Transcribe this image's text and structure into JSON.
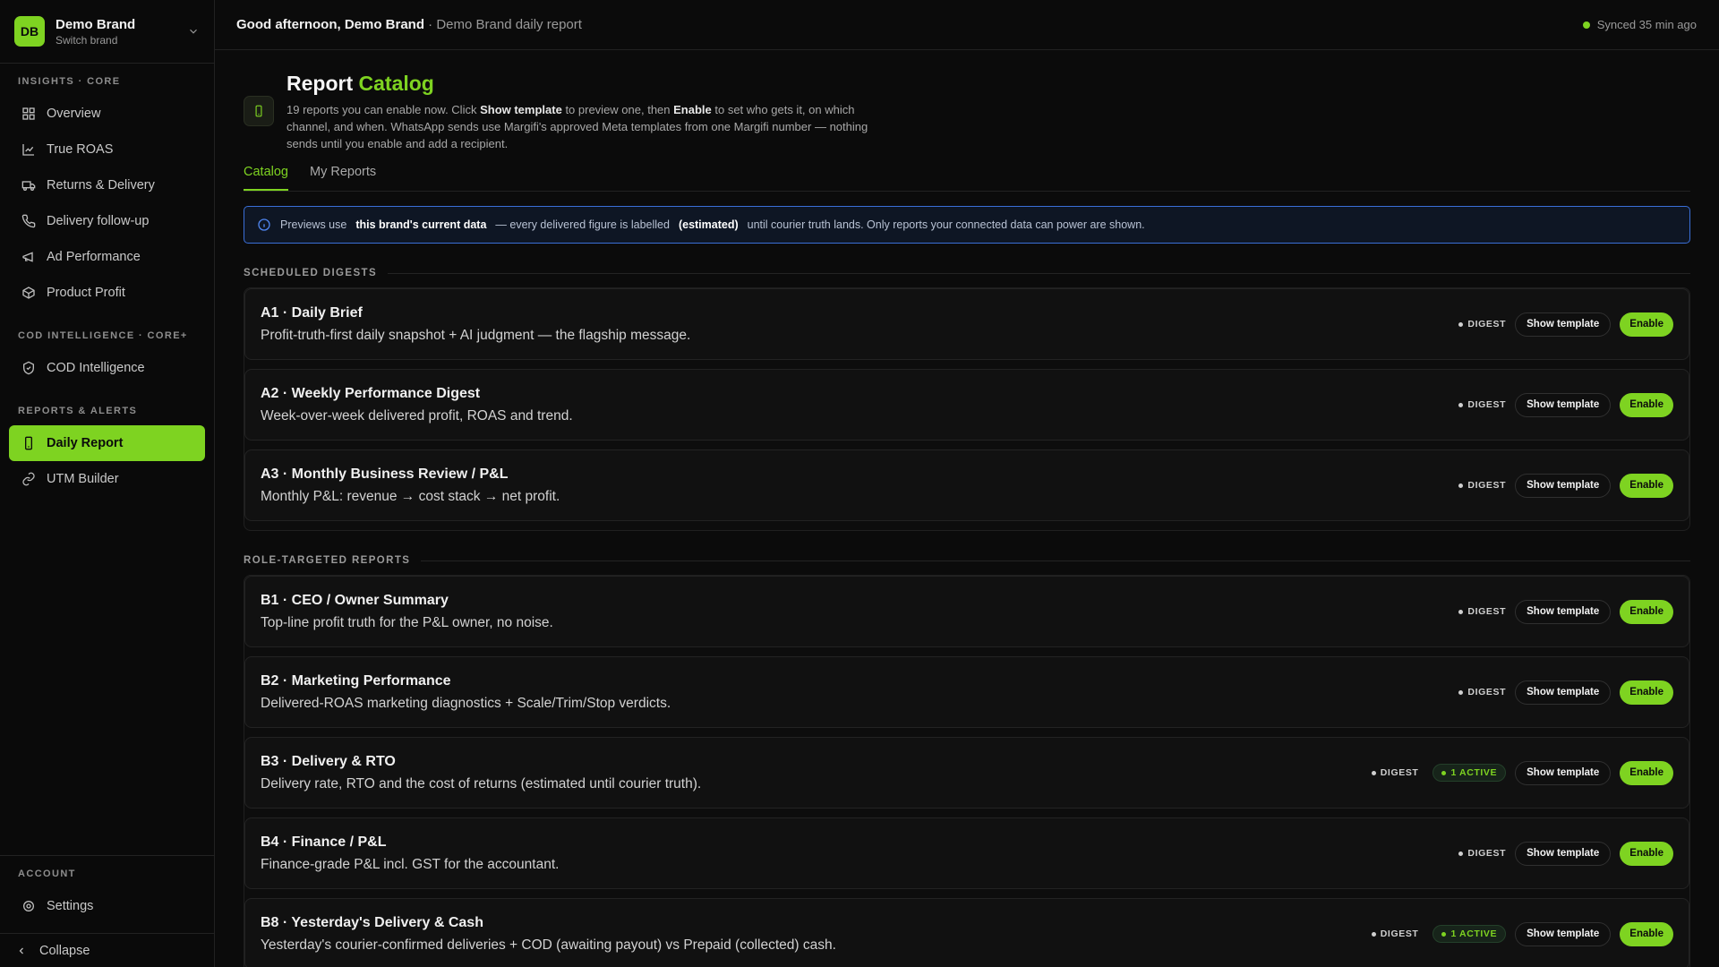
{
  "brand": {
    "initials": "DB",
    "name": "Demo Brand",
    "sub": "Switch brand"
  },
  "sidebar": {
    "sections": [
      {
        "title": "INSIGHTS · CORE",
        "items": [
          {
            "label": "Overview",
            "icon": "grid-icon"
          },
          {
            "label": "True ROAS",
            "icon": "chart-line-icon"
          },
          {
            "label": "Returns & Delivery",
            "icon": "truck-icon"
          },
          {
            "label": "Delivery follow-up",
            "icon": "phone-icon"
          },
          {
            "label": "Ad Performance",
            "icon": "megaphone-icon"
          },
          {
            "label": "Product Profit",
            "icon": "box-icon"
          }
        ]
      },
      {
        "title": "COD INTELLIGENCE · CORE+",
        "items": [
          {
            "label": "COD Intelligence",
            "icon": "shield-icon"
          }
        ]
      },
      {
        "title": "REPORTS & ALERTS",
        "items": [
          {
            "label": "Daily Report",
            "icon": "phone-device-icon",
            "active": true
          },
          {
            "label": "UTM Builder",
            "icon": "link-icon"
          }
        ]
      }
    ],
    "account": {
      "title": "ACCOUNT",
      "settings": "Settings"
    },
    "collapse": "Collapse"
  },
  "topbar": {
    "greeting": "Good afternoon, Demo Brand",
    "sub": "· Demo Brand daily report",
    "sync": "Synced 35 min ago",
    "sync_color": "#7ed321"
  },
  "page": {
    "title": "Report",
    "title_accent": "Catalog",
    "desc_1": "19 reports you can enable now. Click ",
    "desc_b1": "Show template",
    "desc_2": " to preview one, then ",
    "desc_b2": "Enable",
    "desc_3": " to set who gets it, on which channel, and when. WhatsApp sends use Margifi's approved Meta templates from one Margifi number — nothing sends until you enable and add a recipient."
  },
  "tabs": [
    "Catalog",
    "My Reports"
  ],
  "info": {
    "t1": "Previews use",
    "b1": "this brand's current data",
    "t2": "— every delivered figure is labelled",
    "b2": "(estimated)",
    "t3": "until courier truth lands. Only reports your connected data can power are shown."
  },
  "labels": {
    "digest": "DIGEST",
    "show": "Show template",
    "enable": "Enable",
    "active": "1 ACTIVE"
  },
  "sections": [
    {
      "title": "SCHEDULED DIGESTS",
      "cards": [
        {
          "title": "A1 · Daily Brief",
          "desc": "Profit-truth-first daily snapshot + AI judgment — the flagship message.",
          "active": false
        },
        {
          "title": "A2 · Weekly Performance Digest",
          "desc": "Week-over-week delivered profit, ROAS and trend.",
          "active": false
        },
        {
          "title": "A3 · Monthly Business Review / P&L",
          "desc": "Monthly P&L: revenue → cost stack → net profit.",
          "active": false
        }
      ]
    },
    {
      "title": "ROLE-TARGETED REPORTS",
      "cards": [
        {
          "title": "B1 · CEO / Owner Summary",
          "desc": "Top-line profit truth for the P&L owner, no noise.",
          "active": false
        },
        {
          "title": "B2 · Marketing Performance",
          "desc": "Delivered-ROAS marketing diagnostics + Scale/Trim/Stop verdicts.",
          "active": false
        },
        {
          "title": "B3 · Delivery & RTO",
          "desc": "Delivery rate, RTO and the cost of returns (estimated until courier truth).",
          "active": true
        },
        {
          "title": "B4 · Finance / P&L",
          "desc": "Finance-grade P&L incl. GST for the accountant.",
          "active": false
        },
        {
          "title": "B8 · Yesterday's Delivery & Cash",
          "desc": "Yesterday's courier-confirmed deliveries + COD (awaiting payout) vs Prepaid (collected) cash.",
          "active": true
        }
      ]
    }
  ]
}
